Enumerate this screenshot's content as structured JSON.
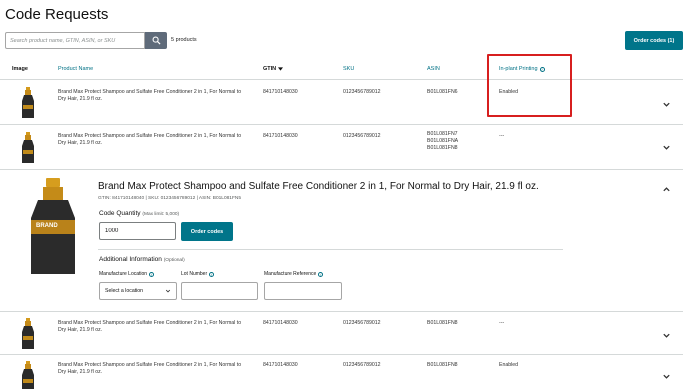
{
  "page": {
    "title": "Code Requests",
    "search_placeholder": "Search product name, GTIN, ASIN, or SKU",
    "product_count": "5 products",
    "order_codes_button": "Order codes (1)"
  },
  "columns": {
    "image": "Image",
    "product_name": "Product Name",
    "gtin": "GTIN",
    "sku": "SKU",
    "asin": "ASIN",
    "inplant": "In-plant Printing"
  },
  "rows": [
    {
      "name": "Brand Max Protect Shampoo and Sulfate Free Conditioner 2 in 1, For Normal to Dry Hair, 21.9 fl oz.",
      "gtin": "841710148030",
      "sku": "0123456789012",
      "asin": [
        "B01L081FN6"
      ],
      "inplant": "Enabled"
    },
    {
      "name": "Brand Max Protect Shampoo and Sulfate Free Conditioner 2 in 1, For Normal to Dry Hair, 21.9 fl oz.",
      "gtin": "841710148030",
      "sku": "0123456789012",
      "asin": [
        "B01L081FN7",
        "B01L081FNA",
        "B01L081FN8"
      ],
      "inplant": "---"
    },
    {
      "name": "Brand Max Protect Shampoo and Sulfate Free Conditioner 2 in 1, For Normal to Dry Hair, 21.9 fl oz.",
      "gtin": "841710148030",
      "sku": "0123456789012",
      "asin": [
        "B01L081FN8"
      ],
      "inplant": "---"
    },
    {
      "name": "Brand Max Protect Shampoo and Sulfate Free Conditioner 2 in 1, For Normal to Dry Hair, 21.9 fl oz.",
      "gtin": "841710148030",
      "sku": "0123456789012",
      "asin": [
        "B01L081FN8"
      ],
      "inplant": "Enabled"
    }
  ],
  "expanded": {
    "title": "Brand Max Protect Shampoo and Sulfate Free Conditioner 2 in 1, For Normal to Dry Hair, 21.9 fl oz.",
    "meta": "GTIN: 841710148040  |  SKU: 0123456789012  |  ASIN: B01L081FN5",
    "bottle_label": "BRAND",
    "quantity_label": "Code Quantity",
    "quantity_limit": "(Max limit: 5,000)",
    "quantity_value": "1000",
    "order_button": "Order codes",
    "additional_label": "Additional Information",
    "additional_optional": "(Optional)",
    "manufacture_location_label": "Manufacture Location",
    "lot_number_label": "Lot Number",
    "manufacture_reference_label": "Manufacture Reference",
    "select_location": "Select a location"
  },
  "colors": {
    "teal": "#00758a",
    "highlight": "#d71f1f",
    "link": "#007185"
  }
}
